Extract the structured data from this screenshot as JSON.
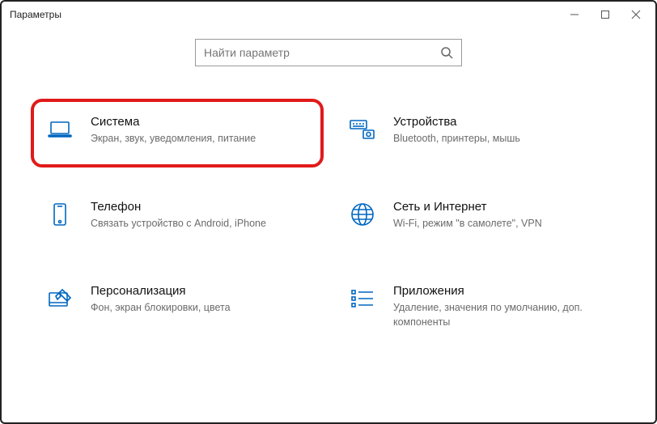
{
  "window": {
    "title": "Параметры"
  },
  "search": {
    "placeholder": "Найти параметр"
  },
  "tiles": {
    "system": {
      "name": "Система",
      "desc": "Экран, звук, уведомления, питание"
    },
    "devices": {
      "name": "Устройства",
      "desc": "Bluetooth, принтеры, мышь"
    },
    "phone": {
      "name": "Телефон",
      "desc": "Связать устройство с Android, iPhone"
    },
    "network": {
      "name": "Сеть и Интернет",
      "desc": "Wi-Fi, режим \"в самолете\", VPN"
    },
    "personalize": {
      "name": "Персонализация",
      "desc": "Фон, экран блокировки, цвета"
    },
    "apps": {
      "name": "Приложения",
      "desc": "Удаление, значения по умолчанию, доп. компоненты"
    }
  }
}
